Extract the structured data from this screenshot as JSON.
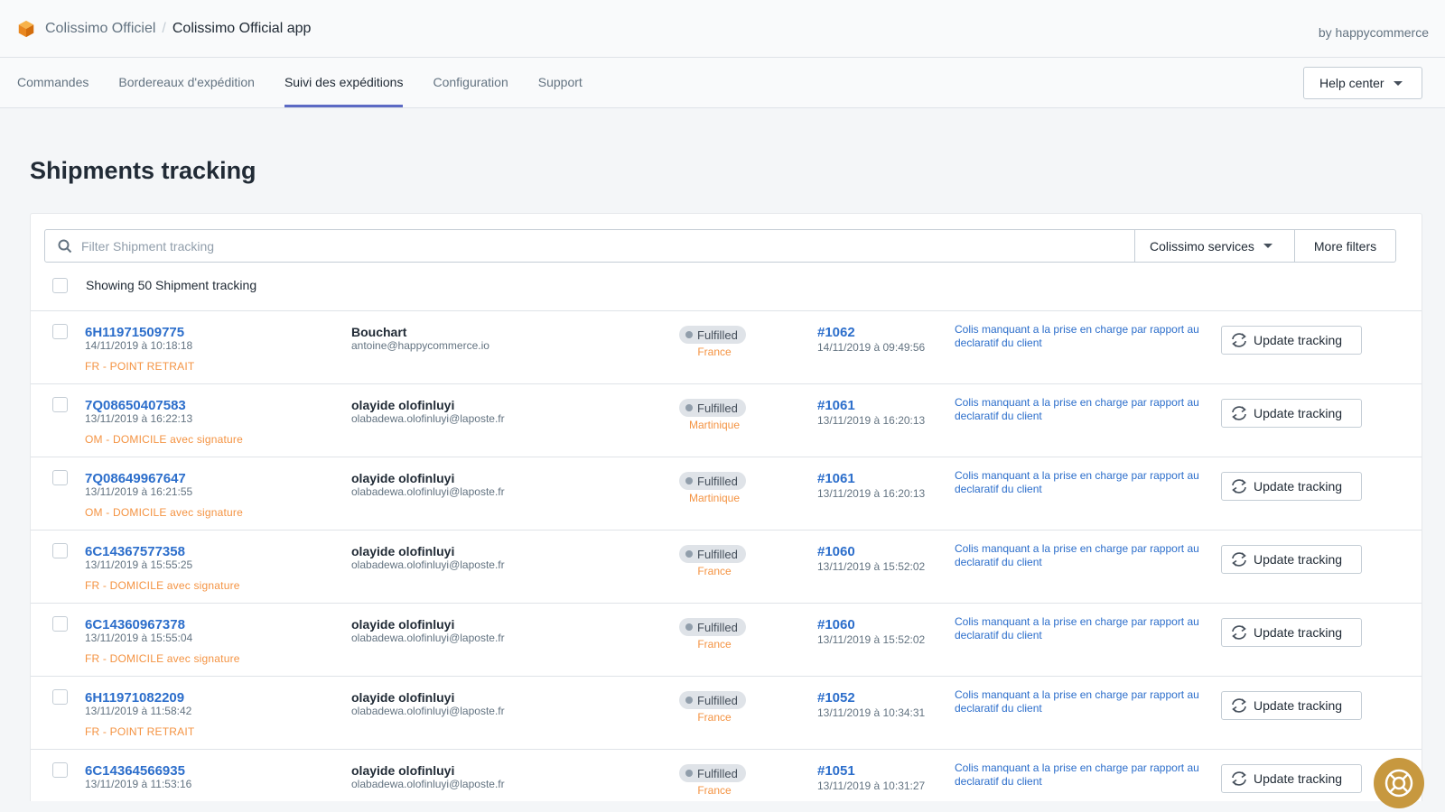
{
  "header": {
    "app_name": "Colissimo Officiel",
    "separator": "/",
    "page_name": "Colissimo Official app",
    "byline": "by happycommerce"
  },
  "tabs": [
    {
      "label": "Commandes"
    },
    {
      "label": "Bordereaux d'expédition"
    },
    {
      "label": "Suivi des expéditions",
      "active": true
    },
    {
      "label": "Configuration"
    },
    {
      "label": "Support"
    }
  ],
  "help_center": {
    "label": "Help center"
  },
  "page": {
    "title": "Shipments tracking"
  },
  "filters": {
    "placeholder": "Filter Shipment tracking",
    "services_label": "Colissimo services",
    "more_label": "More filters"
  },
  "list": {
    "showing": "Showing 50 Shipment tracking"
  },
  "update_label": "Update tracking",
  "status_label": "Fulfilled",
  "rows": [
    {
      "tracking": "6H11971509775",
      "date": "14/11/2019 à 10:18:18",
      "service": "FR - POINT RETRAIT",
      "name": "Bouchart",
      "email": "antoine@happycommerce.io",
      "country": "France",
      "order": "#1062",
      "order_date": "14/11/2019 à 09:49:56",
      "note": "Colis manquant a la prise en charge par rapport au declaratif du client"
    },
    {
      "tracking": "7Q08650407583",
      "date": "13/11/2019 à 16:22:13",
      "service": "OM - DOMICILE avec signature",
      "name": "olayide olofinluyi",
      "email": "olabadewa.olofinluyi@laposte.fr",
      "country": "Martinique",
      "order": "#1061",
      "order_date": "13/11/2019 à 16:20:13",
      "note": "Colis manquant a la prise en charge par rapport au declaratif du client"
    },
    {
      "tracking": "7Q08649967647",
      "date": "13/11/2019 à 16:21:55",
      "service": "OM - DOMICILE avec signature",
      "name": "olayide olofinluyi",
      "email": "olabadewa.olofinluyi@laposte.fr",
      "country": "Martinique",
      "order": "#1061",
      "order_date": "13/11/2019 à 16:20:13",
      "note": "Colis manquant a la prise en charge par rapport au declaratif du client"
    },
    {
      "tracking": "6C14367577358",
      "date": "13/11/2019 à 15:55:25",
      "service": "FR - DOMICILE avec signature",
      "name": "olayide olofinluyi",
      "email": "olabadewa.olofinluyi@laposte.fr",
      "country": "France",
      "order": "#1060",
      "order_date": "13/11/2019 à 15:52:02",
      "note": "Colis manquant a la prise en charge par rapport au declaratif du client"
    },
    {
      "tracking": "6C14360967378",
      "date": "13/11/2019 à 15:55:04",
      "service": "FR - DOMICILE avec signature",
      "name": "olayide olofinluyi",
      "email": "olabadewa.olofinluyi@laposte.fr",
      "country": "France",
      "order": "#1060",
      "order_date": "13/11/2019 à 15:52:02",
      "note": "Colis manquant a la prise en charge par rapport au declaratif du client"
    },
    {
      "tracking": "6H11971082209",
      "date": "13/11/2019 à 11:58:42",
      "service": "FR - POINT RETRAIT",
      "name": "olayide olofinluyi",
      "email": "olabadewa.olofinluyi@laposte.fr",
      "country": "France",
      "order": "#1052",
      "order_date": "13/11/2019 à 10:34:31",
      "note": "Colis manquant a la prise en charge par rapport au declaratif du client"
    },
    {
      "tracking": "6C14364566935",
      "date": "13/11/2019 à 11:53:16",
      "service": "",
      "name": "olayide olofinluyi",
      "email": "olabadewa.olofinluyi@laposte.fr",
      "country": "France",
      "order": "#1051",
      "order_date": "13/11/2019 à 10:31:27",
      "note": "Colis manquant a la prise en charge par rapport au declaratif du client"
    }
  ],
  "icons": {
    "logo": "box-logo-icon",
    "search": "search-icon",
    "caret": "caret-down-icon",
    "update": "refresh-icon",
    "help_fab": "lifebuoy-icon"
  },
  "colors": {
    "accent": "#5c6ac4",
    "link": "#2c6ecb",
    "service": "#f49342",
    "badge_bg": "#dfe3e8",
    "fab": "#c7983f"
  }
}
